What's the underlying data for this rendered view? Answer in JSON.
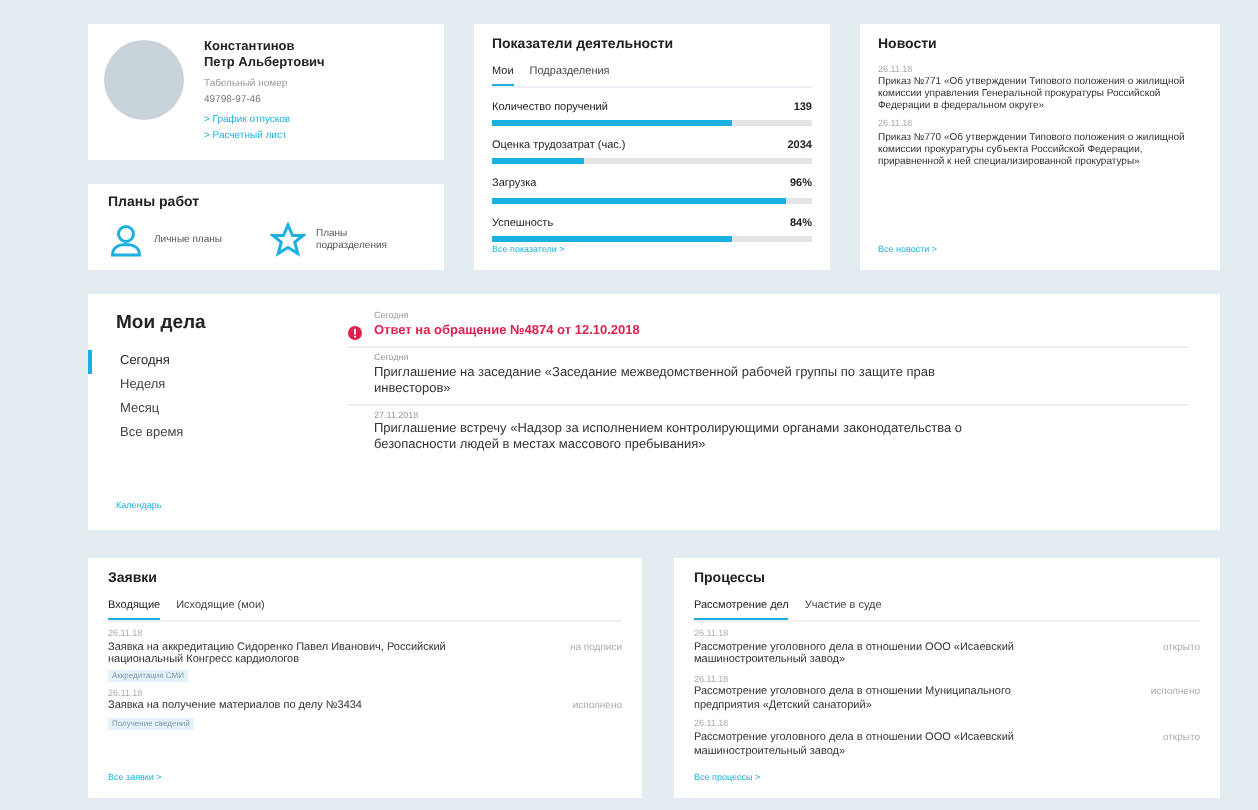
{
  "profile": {
    "name_line1": "Константинов",
    "name_line2": "Петр Альбертович",
    "number_label": "Табельный номер",
    "number": "49798-97-46",
    "links": [
      "> График отпусков",
      "> Расчетный лист"
    ]
  },
  "plans": {
    "title": "Планы работ",
    "items": [
      {
        "kind": "person",
        "label": "Личные планы"
      },
      {
        "kind": "star",
        "label": "Планы подразделения"
      }
    ]
  },
  "indicators": {
    "title": "Показатели деятельности",
    "tabs": [
      {
        "label": "Мои",
        "selected": true
      },
      {
        "label": "Подразделения",
        "selected": false
      }
    ],
    "rows": [
      {
        "label": "Количество поручений",
        "value": "139",
        "level": 0.75
      },
      {
        "label": "Оценка трудозатрат (час.)",
        "value": "2034",
        "level": 0.29
      },
      {
        "label": "Загрузка",
        "value": "96%",
        "level": 0.92
      },
      {
        "label": "Успешность",
        "value": "84%",
        "level": 0.75
      }
    ],
    "link": "Все показатели >"
  },
  "news": {
    "title": "Новости",
    "items": [
      {
        "date": "26.11.18",
        "text": "Приказ №771 «Об утверждении Типового положения о жилищной комиссии управления Генеральной прокуратуры Российской Федерации в федеральном округе»"
      },
      {
        "date": "26.11.18",
        "text": "Приказ №770 «Об утверждении Типового положения о жилищной комиссии прокуратуры субъекта Российской Федерации, приравненной к ней специализированной прокуратуры»"
      }
    ],
    "link": "Все новости >"
  },
  "my_tasks": {
    "title": "Мои дела",
    "periods": [
      {
        "label": "Сегодня",
        "selected": true
      },
      {
        "label": "Неделя",
        "selected": false
      },
      {
        "label": "Месяц",
        "selected": false
      },
      {
        "label": "Все время",
        "selected": false
      }
    ],
    "calendar_link": "Календарь",
    "items": [
      {
        "date": "Сегодня",
        "text": "Ответ на обращение №4874 от 12.10.2018",
        "urgent": true
      },
      {
        "date": "Сегодня",
        "text": "Приглашение на заседание «Заседание межведомственной рабочей группы по защите прав инвесторов»",
        "urgent": false
      },
      {
        "date": "27.11.2018",
        "text": "Приглашение встречу «Надзор за исполнением контролирующими органами законодательства о безопасности людей в местах массового пребывания»",
        "urgent": false
      }
    ]
  },
  "requests": {
    "title": "Заявки",
    "tabs": [
      {
        "label": "Входящие",
        "selected": true
      },
      {
        "label": "Исходящие (мои)",
        "selected": false
      }
    ],
    "items": [
      {
        "date": "26.11.18",
        "text": "Заявка на аккредитацию Сидоренко Павел Иванович, Российский национальный Конгресс кардиологов",
        "tag": "Аккредитация СМИ",
        "status": "на подписи"
      },
      {
        "date": "26.11.18",
        "text": "Заявка на получение материалов по делу №3434",
        "tag": "Получение сведений",
        "status": "исполнено"
      }
    ],
    "link": "Все заявки >"
  },
  "processes": {
    "title": "Процессы",
    "tabs": [
      {
        "label": "Рассмотрение дел",
        "selected": true
      },
      {
        "label": "Участие в суде",
        "selected": false
      }
    ],
    "items": [
      {
        "date": "26.11.18",
        "text": "Рассмотрение уголовного дела в отношении ООО «Исаевский машиностроительный завод»",
        "status": "открыто"
      },
      {
        "date": "26.11.18",
        "text": "Рассмотрение уголовного дела в отношении Муниципального предприятия «Детский санаторий»",
        "status": "исполнено"
      },
      {
        "date": "26.11.18",
        "text": "Рассмотрение уголовного дела в отношении ООО «Исаевский машиностроительный завод»",
        "status": "открыто"
      }
    ],
    "link": "Все процессы >"
  }
}
